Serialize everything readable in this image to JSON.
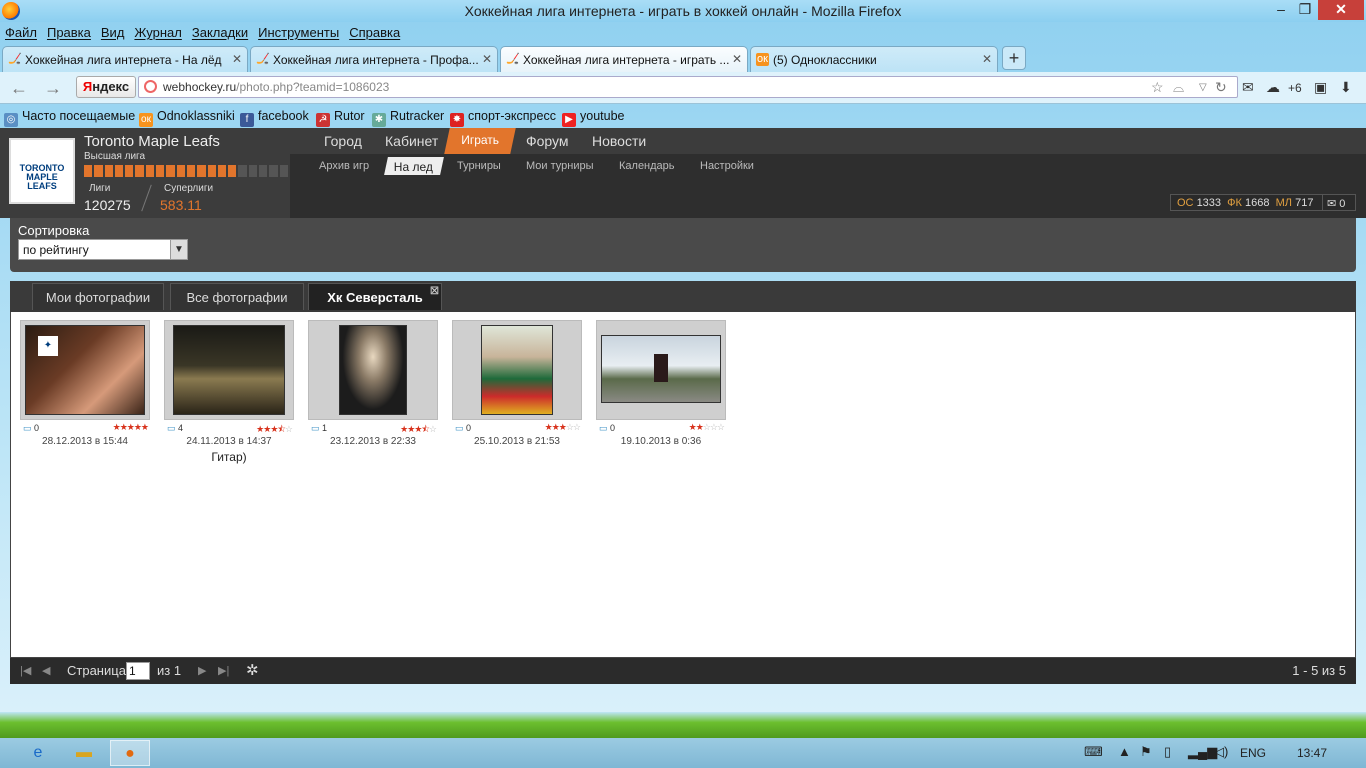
{
  "window": {
    "title": "Хоккейная лига интернета - играть в хоккей онлайн - Mozilla Firefox"
  },
  "menu": [
    "Файл",
    "Правка",
    "Вид",
    "Журнал",
    "Закладки",
    "Инструменты",
    "Справка"
  ],
  "tabs": [
    {
      "label": "Хоккейная лига интернета - На лёд"
    },
    {
      "label": "Хоккейная лига интернета - Профа..."
    },
    {
      "label": "Хоккейная лига интернета - играть ..."
    },
    {
      "label": "(5) Одноклассники"
    }
  ],
  "nav": {
    "yandex_prefix": "Я",
    "yandex_rest": "ндекс",
    "url_host": "webhockey.ru",
    "url_path": "/photo.php?teamid=1086023",
    "notify_count": "+6"
  },
  "bookmarks": [
    "Часто посещаемые",
    "Odnoklassniki",
    "facebook",
    "Rutor",
    "Rutracker",
    "спорт-экспресс",
    "youtube"
  ],
  "team": {
    "logo_text": [
      "TORONTO",
      "MAPLE",
      "LEAFS"
    ],
    "name": "Toronto Maple Leafs",
    "league": "Высшая лига",
    "progress_segments": 20,
    "progress_filled": 15,
    "ligi_label": "Лиги",
    "ligi_value": "120275",
    "super_label": "Суперлиги",
    "super_value": "583.11"
  },
  "mainnav": [
    "Город",
    "Кабинет",
    "Играть",
    "Форум",
    "Новости"
  ],
  "subnav": [
    "Архив игр",
    "На лед",
    "Турниры",
    "Мои турниры",
    "Календарь",
    "Настройки"
  ],
  "stats": {
    "os_label": "ОС",
    "os": "1333",
    "fk_label": "ФК",
    "fk": "1668",
    "ml_label": "МЛ",
    "ml": "717",
    "mail": "0"
  },
  "sort": {
    "label": "Сортировка",
    "value": "по рейтингу"
  },
  "gallery_tabs": [
    "Мои фотографии",
    "Все фотографии",
    "Хк Северсталь"
  ],
  "photos": [
    {
      "comments": "0",
      "rating": 5,
      "date": "28.12.2013 в 15:44",
      "caption": ""
    },
    {
      "comments": "4",
      "rating": 3.5,
      "date": "24.11.2013 в 14:37",
      "caption": "Гитар)"
    },
    {
      "comments": "1",
      "rating": 3.5,
      "date": "23.12.2013 в 22:33",
      "caption": ""
    },
    {
      "comments": "0",
      "rating": 3,
      "date": "25.10.2013 в 21:53",
      "caption": ""
    },
    {
      "comments": "0",
      "rating": 2,
      "date": "19.10.2013 в 0:36",
      "caption": ""
    }
  ],
  "pager": {
    "page_label": "Страница",
    "page": "1",
    "of_label": "из 1",
    "range": "1 - 5 из 5"
  },
  "taskbar": {
    "lang": "ENG",
    "time": "13:47"
  }
}
